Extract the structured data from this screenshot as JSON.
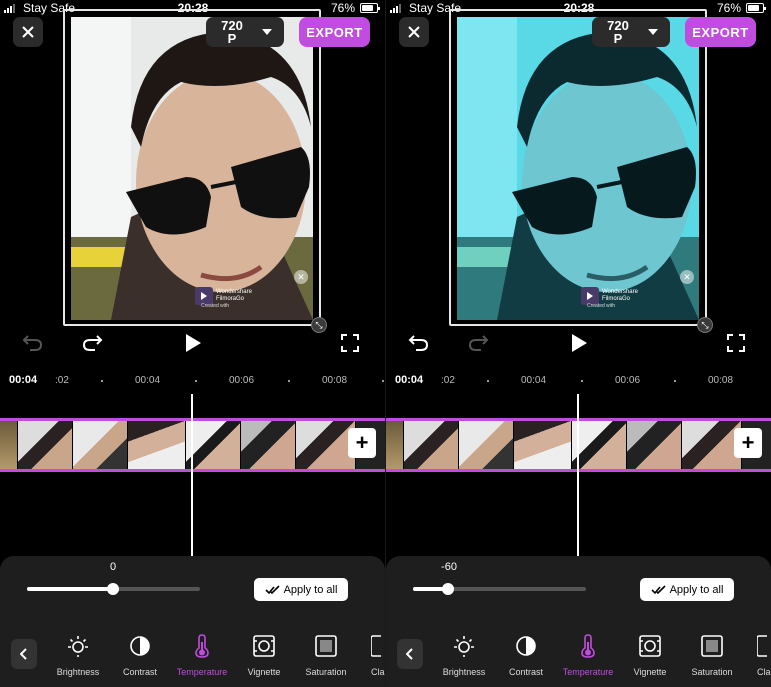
{
  "panels": [
    {
      "status": {
        "carrier": "Stay Safe",
        "time": "20:28",
        "battery": "76%"
      },
      "resolution": "720\nP",
      "export_label": "EXPORT",
      "watermark": {
        "brand": "Wondershare\nFilmoraGo",
        "created": "Created with"
      },
      "timeline": {
        "current": "00:04",
        "ticks": [
          ":02",
          "00:04",
          "00:06",
          "00:08"
        ]
      },
      "adjust": {
        "value": "0",
        "level": 0.5
      },
      "apply_label": "Apply to all",
      "tools": [
        "Brightness",
        "Contrast",
        "Temperature",
        "Vignette",
        "Saturation",
        "Cla"
      ],
      "active_tool": "Temperature"
    },
    {
      "status": {
        "carrier": "Stay Safe",
        "time": "20:28",
        "battery": "76%"
      },
      "resolution": "720\nP",
      "export_label": "EXPORT",
      "watermark": {
        "brand": "Wondershare\nFilmoraGo",
        "created": "Created with"
      },
      "timeline": {
        "current": "00:04",
        "ticks": [
          ":02",
          "00:04",
          "00:06",
          "00:08"
        ]
      },
      "adjust": {
        "value": "-60",
        "level": 0.2
      },
      "apply_label": "Apply to all",
      "tools": [
        "Brightness",
        "Contrast",
        "Temperature",
        "Vignette",
        "Saturation",
        "Cla"
      ],
      "active_tool": "Temperature"
    }
  ],
  "colors": {
    "accent": "#c04ce0",
    "panel_bg": "#1e1e1e",
    "button_bg": "#2b2b2b"
  },
  "icons": [
    "close-icon",
    "chevron-down-icon",
    "undo-icon",
    "redo-icon",
    "play-icon",
    "fullscreen-icon",
    "add-icon",
    "check-icon",
    "chevron-left-icon",
    "brightness-icon",
    "contrast-icon",
    "temperature-icon",
    "vignette-icon",
    "saturation-icon"
  ]
}
